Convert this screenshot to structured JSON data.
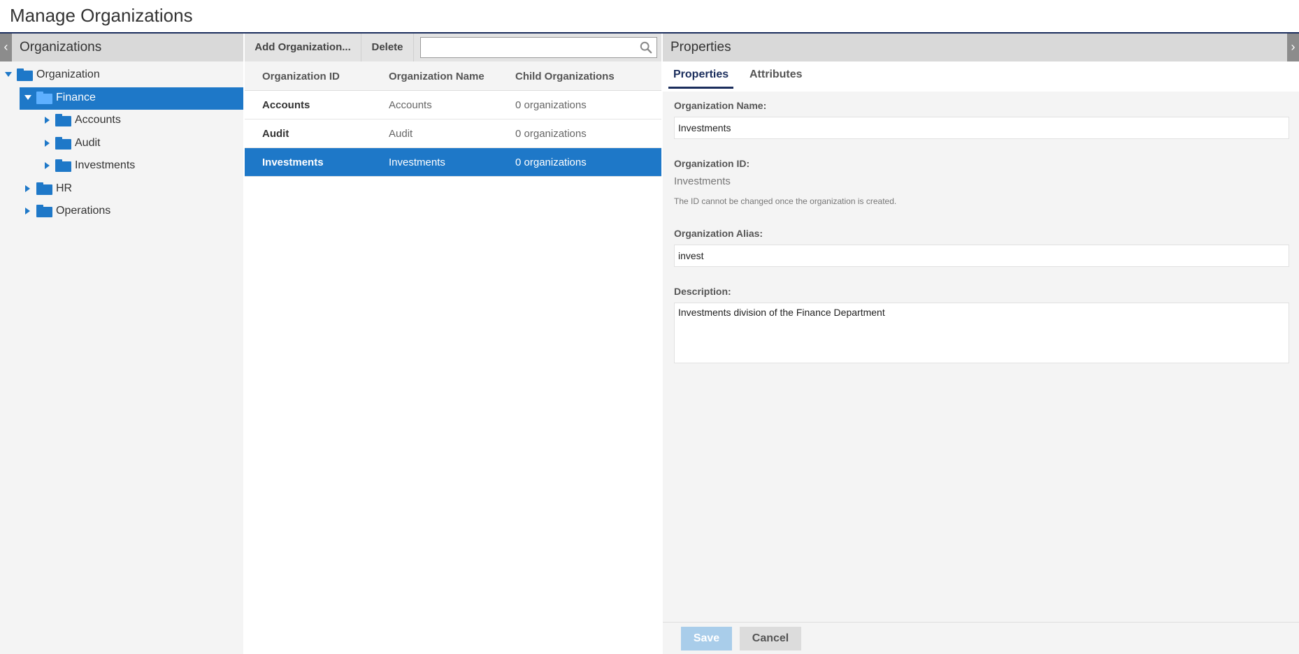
{
  "page": {
    "title": "Manage Organizations"
  },
  "left_panel": {
    "header": "Organizations",
    "collapse_icon": "chevron-left-icon",
    "tree": [
      {
        "label": "Organization",
        "level": 0,
        "expanded": true,
        "selected": false
      },
      {
        "label": "Finance",
        "level": 1,
        "expanded": true,
        "selected": true
      },
      {
        "label": "Accounts",
        "level": 2,
        "expanded": false,
        "selected": false
      },
      {
        "label": "Audit",
        "level": 2,
        "expanded": false,
        "selected": false
      },
      {
        "label": "Investments",
        "level": 2,
        "expanded": false,
        "selected": false
      },
      {
        "label": "HR",
        "level": 1,
        "expanded": false,
        "selected": false
      },
      {
        "label": "Operations",
        "level": 1,
        "expanded": false,
        "selected": false
      }
    ]
  },
  "toolbar": {
    "add_label": "Add Organization...",
    "delete_label": "Delete",
    "search_value": "",
    "search_icon": "search-icon"
  },
  "grid": {
    "columns": [
      "Organization ID",
      "Organization Name",
      "Child Organizations"
    ],
    "rows": [
      {
        "id": "Accounts",
        "name": "Accounts",
        "children": "0 organizations",
        "selected": false
      },
      {
        "id": "Audit",
        "name": "Audit",
        "children": "0 organizations",
        "selected": false
      },
      {
        "id": "Investments",
        "name": "Investments",
        "children": "0 organizations",
        "selected": true
      }
    ]
  },
  "right_panel": {
    "header": "Properties",
    "expand_icon": "chevron-right-icon",
    "tabs": [
      {
        "label": "Properties",
        "active": true
      },
      {
        "label": "Attributes",
        "active": false
      }
    ],
    "form": {
      "name_label": "Organization Name:",
      "name_value": "Investments",
      "id_label": "Organization ID:",
      "id_value": "Investments",
      "id_hint": "The ID cannot be changed once the organization is created.",
      "alias_label": "Organization Alias:",
      "alias_value": "invest",
      "description_label": "Description:",
      "description_value": "Investments division of the Finance Department"
    },
    "save_label": "Save",
    "cancel_label": "Cancel"
  },
  "colors": {
    "accent": "#1e78c8",
    "header_rule": "#1a2d5c",
    "save_disabled": "#a9cdea"
  }
}
